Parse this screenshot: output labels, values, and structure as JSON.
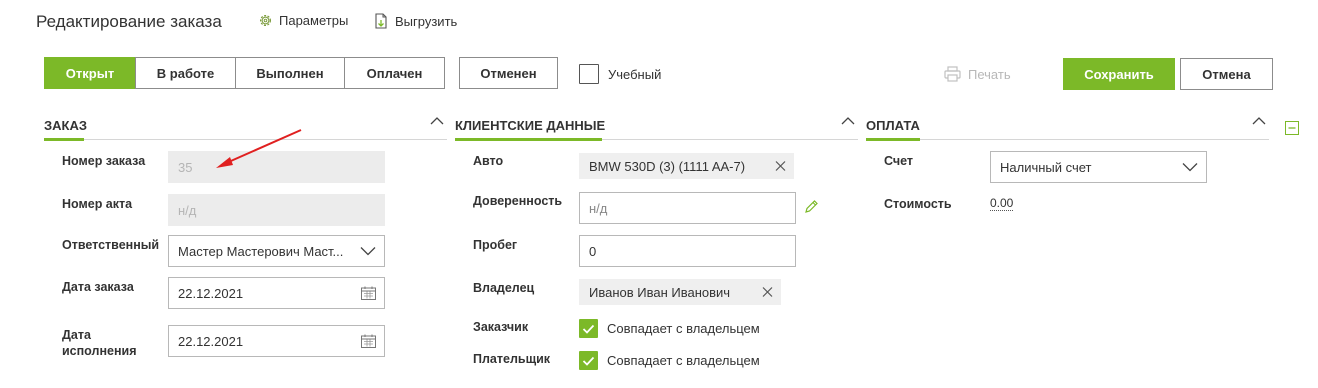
{
  "header": {
    "title": "Редактирование заказа",
    "params_label": "Параметры",
    "export_label": "Выгрузить"
  },
  "statuses": {
    "open": "Открыт",
    "in_work": "В работе",
    "done": "Выполнен",
    "paid": "Оплачен",
    "cancelled": "Отменен",
    "training": "Учебный"
  },
  "actions": {
    "print": "Печать",
    "save": "Сохранить",
    "cancel": "Отмена"
  },
  "order": {
    "section_title": "ЗАКАЗ",
    "number_label": "Номер заказа",
    "number_value": "35",
    "act_label": "Номер акта",
    "act_placeholder": "н/д",
    "responsible_label": "Ответственный",
    "responsible_value": "Мастер Мастерович Маст...",
    "order_date_label": "Дата заказа",
    "order_date_value": "22.12.2021",
    "exec_date_label_line1": "Дата",
    "exec_date_label_line2": "исполнения",
    "exec_date_value": "22.12.2021"
  },
  "client": {
    "section_title": "КЛИЕНТСКИЕ ДАННЫЕ",
    "car_label": "Авто",
    "car_value": "BMW 530D (3) (1111 AA-7)",
    "proxy_label": "Доверенность",
    "proxy_placeholder": "н/д",
    "mileage_label": "Пробег",
    "mileage_value": "0",
    "owner_label": "Владелец",
    "owner_value": "Иванов Иван Иванович",
    "customer_label": "Заказчик",
    "customer_value": "Совпадает с владельцем",
    "payer_label": "Плательщик",
    "payer_value": "Совпадает с владельцем"
  },
  "payment": {
    "section_title": "ОПЛАТА",
    "account_label": "Счет",
    "account_value": "Наличный счет",
    "cost_label": "Стоимость",
    "cost_value": "0.00"
  },
  "colors": {
    "accent": "#7cb928",
    "annotation_arrow": "#e02020"
  }
}
